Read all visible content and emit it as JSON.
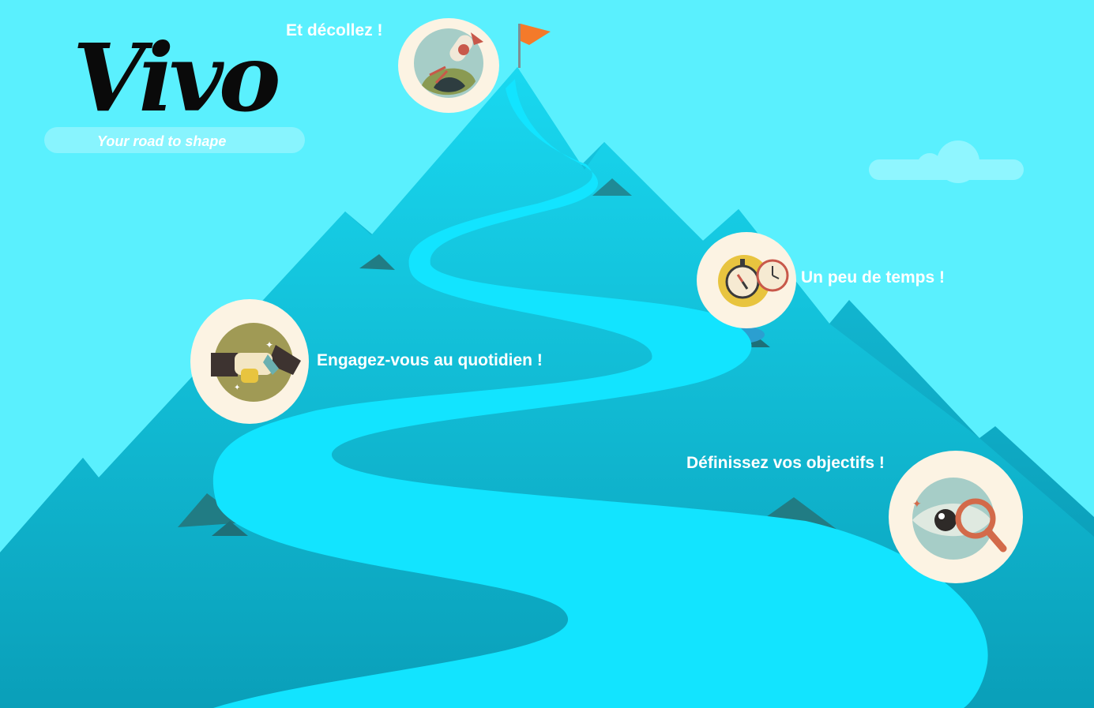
{
  "brand": {
    "name": "Vivo",
    "tagline": "Your road to shape"
  },
  "steps": [
    {
      "label": "Et décollez !",
      "icon": "rocket-icon"
    },
    {
      "label": "Un peu de temps !",
      "icon": "stopwatch-icon"
    },
    {
      "label": "Engagez-vous au quotidien !",
      "icon": "handshake-icon"
    },
    {
      "label": "Définissez vos objectifs !",
      "icon": "eye-magnifier-icon"
    }
  ],
  "colors": {
    "sky": "#5af0fe",
    "mountain": "#15b8d1",
    "mountain_dark": "#0a9bb5",
    "road": "#12e4ff",
    "flag": "#f47a2a",
    "badge_bg": "#fcf3e3"
  }
}
